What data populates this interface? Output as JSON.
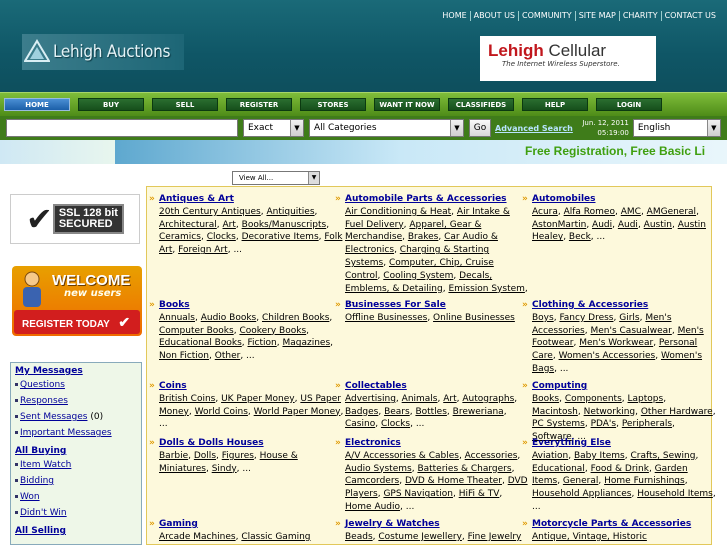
{
  "header": {
    "top_links": [
      "HOME",
      "ABOUT US",
      "COMMUNITY",
      "SITE MAP",
      "CHARITY",
      "CONTACT US"
    ],
    "logo_text": "Lehigh Auctions",
    "banner": {
      "brand_left": "Lehigh",
      "brand_right": "Cellular",
      "tagline": "The Internet Wireless Superstore."
    }
  },
  "nav": [
    "HOME",
    "BUY",
    "SELL",
    "REGISTER",
    "STORES",
    "WANT IT NOW",
    "CLASSIFIEDS",
    "HELP",
    "LOGIN"
  ],
  "search": {
    "input_value": "",
    "match_value": "Exact",
    "category_value": "All Categories",
    "go_label": "Go",
    "advanced_label": "Advanced Search",
    "date": "Jun. 12, 2011",
    "time": "05:19:00",
    "language_value": "English"
  },
  "ticker": "Free Registration, Free Basic Li",
  "view_select": "View All...",
  "sidebar": {
    "ssl_text": [
      "SSL 128 bit",
      "SECURED"
    ],
    "welcome_title": "WELCOME",
    "welcome_sub": "new users",
    "register_label": "REGISTER TODAY",
    "my_messages": "My Messages",
    "messages_items": [
      {
        "label": "Questions",
        "count": ""
      },
      {
        "label": "Responses",
        "count": ""
      },
      {
        "label": "Sent Messages",
        "count": " (0)"
      },
      {
        "label": "Important Messages",
        "count": ""
      }
    ],
    "all_buying": "All Buying",
    "buying_items": [
      "Item Watch",
      "Bidding",
      "Won",
      "Didn't Win"
    ],
    "all_selling": "All Selling"
  },
  "categories": [
    {
      "title": "Antiques & Art",
      "subs": [
        "20th Century Antiques",
        "Antiquities",
        "Architectural",
        "Art",
        "Books/Manuscripts",
        "Ceramics",
        "Clocks",
        "Decorative Items",
        "Folk Art",
        "Foreign Art"
      ]
    },
    {
      "title": "Automobile Parts & Accessories",
      "subs": [
        "Air Conditioning & Heat",
        "Air Intake & Fuel Delivery",
        "Apparel, Gear & Merchandise",
        "Brakes",
        "Car Audio & Electronics",
        "Charging & Starting Systems",
        "Computer, Chip, Cruise Control",
        "Cooling System",
        "Decals, Emblems, & Detailing",
        "Emission System"
      ]
    },
    {
      "title": "Automobiles",
      "subs": [
        "Acura",
        "Alfa Romeo",
        "AMC",
        "AMGeneral",
        "AstonMartin",
        "Audi",
        "Audi",
        "Austin",
        "Austin Healey",
        "Beck"
      ]
    },
    {
      "title": "Books",
      "subs": [
        "Annuals",
        "Audio Books",
        "Children Books",
        "Computer Books",
        "Cookery Books",
        "Educational Books",
        "Fiction",
        "Magazines",
        "Non Fiction",
        "Other"
      ]
    },
    {
      "title": "Businesses For Sale",
      "subs": [
        "Offline Businesses",
        "Online Businesses"
      ]
    },
    {
      "title": "Clothing & Accessories",
      "subs": [
        "Boys",
        "Fancy Dress",
        "Girls",
        "Men's Accessories",
        "Men's Casualwear",
        "Men's Footwear",
        "Men's Workwear",
        "Personal Care",
        "Women's Accessories",
        "Women's Bags"
      ]
    },
    {
      "title": "Coins",
      "subs": [
        "British Coins",
        "UK Paper Money",
        "US Paper Money",
        "World Coins",
        "World Paper Money"
      ]
    },
    {
      "title": "Collectables",
      "subs": [
        "Advertising",
        "Animals",
        "Art",
        "Autographs",
        "Badges",
        "Bears",
        "Bottles",
        "Breweriana",
        "Casino",
        "Clocks"
      ]
    },
    {
      "title": "Computing",
      "subs": [
        "Books",
        "Components",
        "Laptops",
        "Macintosh",
        "Networking",
        "Other Hardware",
        "PC Systems",
        "PDA's",
        "Peripherals",
        "Software"
      ]
    },
    {
      "title": "Dolls & Dolls Houses",
      "subs": [
        "Barbie",
        "Dolls",
        "Figures",
        "House & Miniatures",
        "Sindy"
      ]
    },
    {
      "title": "Electronics",
      "subs": [
        "A/V Accessories & Cables",
        "Accessories",
        "Audio Systems",
        "Batteries & Chargers",
        "Camcorders",
        "DVD & Home Theater",
        "DVD Players",
        "GPS Navigation",
        "HiFi & TV",
        "Home Audio"
      ]
    },
    {
      "title": "Everything Else",
      "subs": [
        "Aviation",
        "Baby Items",
        "Crafts, Sewing",
        "Educational",
        "Food & Drink",
        "Garden Items",
        "General",
        "Home Furnishings",
        "Household Appliances",
        "Household Items"
      ]
    },
    {
      "title": "Gaming",
      "subs": [
        "Arcade Machines",
        "Classic Gaming"
      ]
    },
    {
      "title": "Jewelry & Watches",
      "subs": [
        "Beads",
        "Costume Jewellery",
        "Fine Jewelry"
      ]
    },
    {
      "title": "Motorcycle Parts & Accessories",
      "subs": [
        "Antique, Vintage, Historic"
      ]
    }
  ],
  "more": "...",
  "colors": {
    "header": "#0f5666",
    "nav": "#5c9a20",
    "link": "#000099",
    "accent": "#e09a00"
  }
}
